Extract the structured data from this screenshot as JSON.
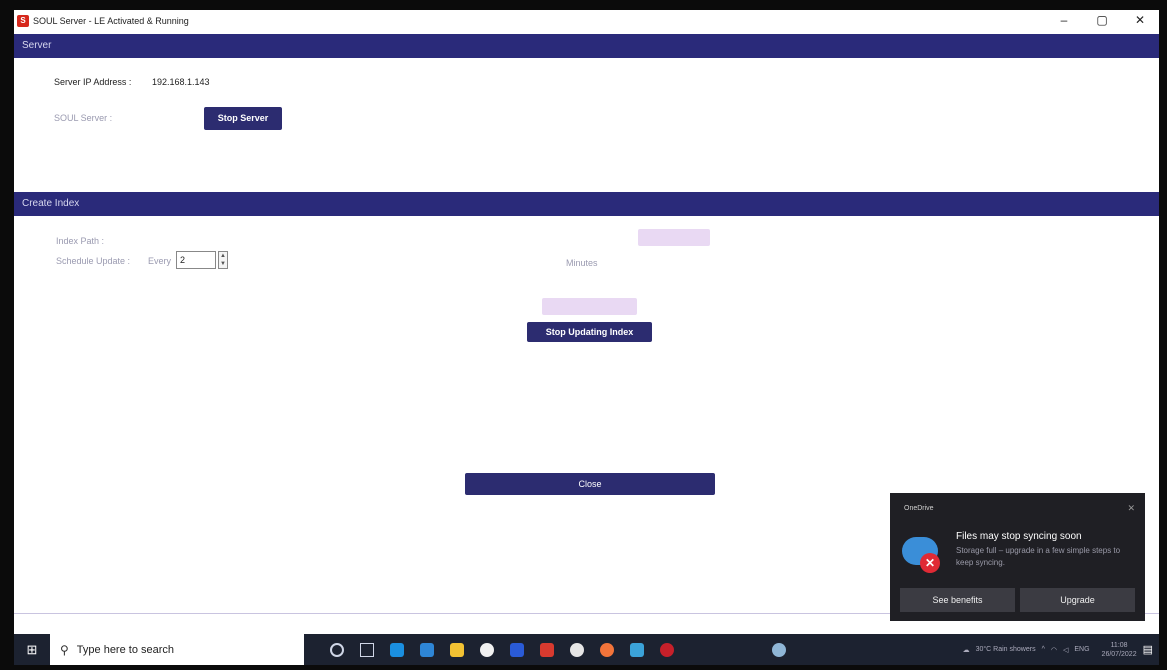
{
  "window": {
    "title": "SOUL Server - LE Activated & Running",
    "minimize": "–",
    "maximize": "▢",
    "close": "✕"
  },
  "server": {
    "header": "Server",
    "ip_label": "Server IP Address :",
    "ip_value": "192.168.1.143",
    "soul_label": "SOUL Server :",
    "stop_button": "Stop Server"
  },
  "index": {
    "header": "Create Index",
    "path_label": "Index Path :",
    "schedule_label": "Schedule Update :",
    "every_label": "Every",
    "interval_value": "2",
    "minutes_label": "Minutes",
    "stop_button": "Stop Updating Index"
  },
  "footer": {
    "close_button": "Close"
  },
  "taskbar": {
    "search_placeholder": "Type here to search",
    "weather": "30°C Rain showers",
    "language": "ENG",
    "time": "11:08",
    "date": "26/07/2022"
  },
  "toast": {
    "app": "OneDrive",
    "title": "Files may stop syncing soon",
    "body": "Storage full – upgrade in a few simple steps to keep syncing.",
    "benefits_button": "See benefits",
    "upgrade_button": "Upgrade"
  },
  "colors": {
    "header_bg": "#2a2a7a",
    "button_bg": "#2c2c70",
    "taskbar_bg": "#1c2230",
    "toast_bg": "#1f1f24"
  }
}
